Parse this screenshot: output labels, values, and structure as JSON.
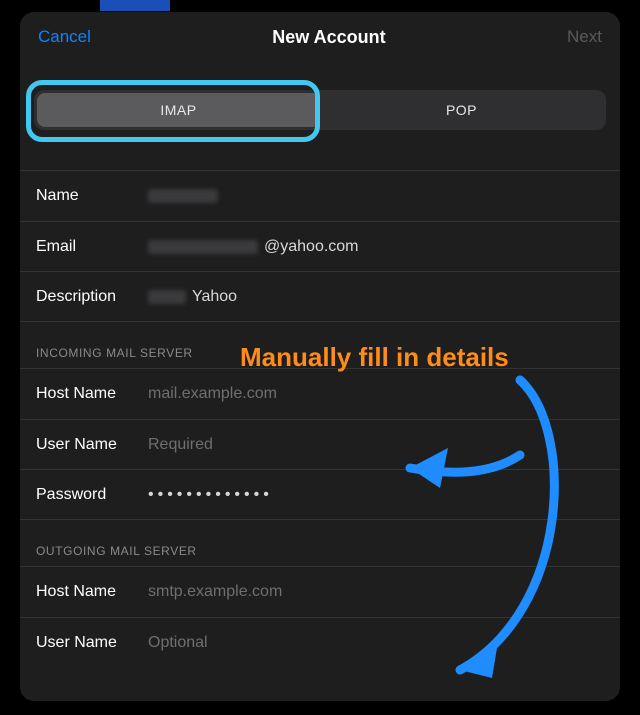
{
  "nav": {
    "cancel": "Cancel",
    "title": "New Account",
    "next": "Next"
  },
  "segments": {
    "imap": "IMAP",
    "pop": "POP"
  },
  "account": {
    "name_label": "Name",
    "email_label": "Email",
    "email_suffix": "@yahoo.com",
    "description_label": "Description",
    "description_suffix": "Yahoo"
  },
  "incoming": {
    "header": "INCOMING MAIL SERVER",
    "host_label": "Host Name",
    "host_placeholder": "mail.example.com",
    "user_label": "User Name",
    "user_placeholder": "Required",
    "password_label": "Password",
    "password_value": "•••••••••••••"
  },
  "outgoing": {
    "header": "OUTGOING MAIL SERVER",
    "host_label": "Host Name",
    "host_placeholder": "smtp.example.com",
    "user_label": "User Name",
    "user_placeholder": "Optional"
  },
  "annotation": {
    "text": "Manually fill in details",
    "colors": {
      "arrow": "#1f8cff",
      "ring": "#43c6f0",
      "text": "#ff8c1a"
    }
  }
}
